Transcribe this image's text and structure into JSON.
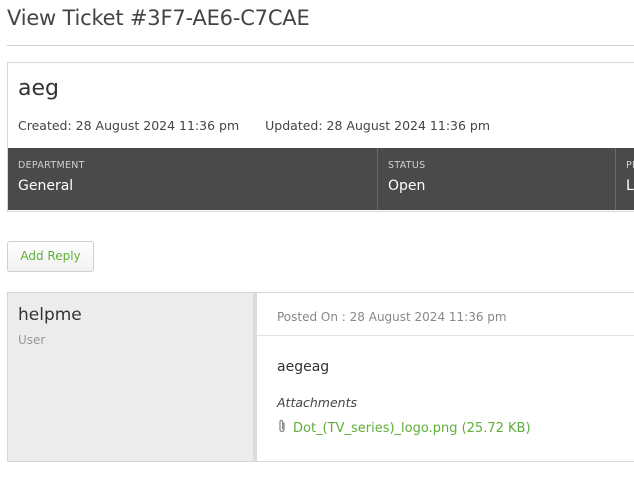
{
  "header": {
    "title": "View Ticket #3F7-AE6-C7CAE"
  },
  "ticket": {
    "subject": "aeg",
    "created": "Created: 28 August 2024 11:36 pm",
    "updated": "Updated: 28 August 2024 11:36 pm",
    "info": [
      {
        "label": "DEPARTMENT",
        "value": "General"
      },
      {
        "label": "STATUS",
        "value": "Open"
      },
      {
        "label": "PR",
        "value": "L"
      }
    ]
  },
  "actions": {
    "add_reply": "Add Reply"
  },
  "reply": {
    "user_name": "helpme",
    "user_role": "User",
    "posted_on": "Posted On : 28 August 2024 11:36 pm",
    "message": "aegeag",
    "attachments_heading": "Attachments",
    "attachment_name": "Dot_(TV_series)_logo.png (25.72 KB)"
  },
  "colors": {
    "accent": "#5fae3a",
    "info_bar": "#4a4a4a",
    "user_panel": "#ececec"
  }
}
